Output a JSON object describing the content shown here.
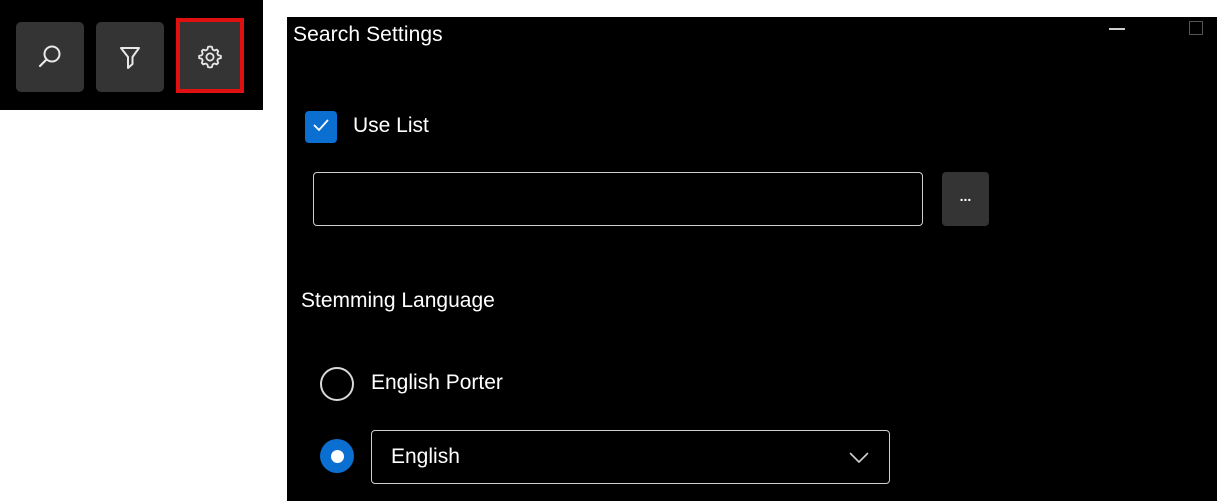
{
  "toolbar": {
    "buttons": [
      {
        "icon": "search-icon"
      },
      {
        "icon": "filter-icon"
      },
      {
        "icon": "gear-icon",
        "highlighted": true
      }
    ],
    "highlight_color": "#e01010"
  },
  "panel": {
    "title": "Search Settings",
    "use_list": {
      "label": "Use List",
      "checked": true
    },
    "list_path": {
      "value": "",
      "placeholder": ""
    },
    "browse_label": "...",
    "stemming": {
      "label": "Stemming Language",
      "options": [
        {
          "label": "English Porter",
          "selected": false
        },
        {
          "label": "English",
          "selected": true,
          "type": "dropdown"
        }
      ],
      "dropdown_value": "English"
    }
  },
  "colors": {
    "accent": "#0a6fd1",
    "panel_bg": "#000000",
    "button_bg": "#343434",
    "text": "#ffffff"
  }
}
